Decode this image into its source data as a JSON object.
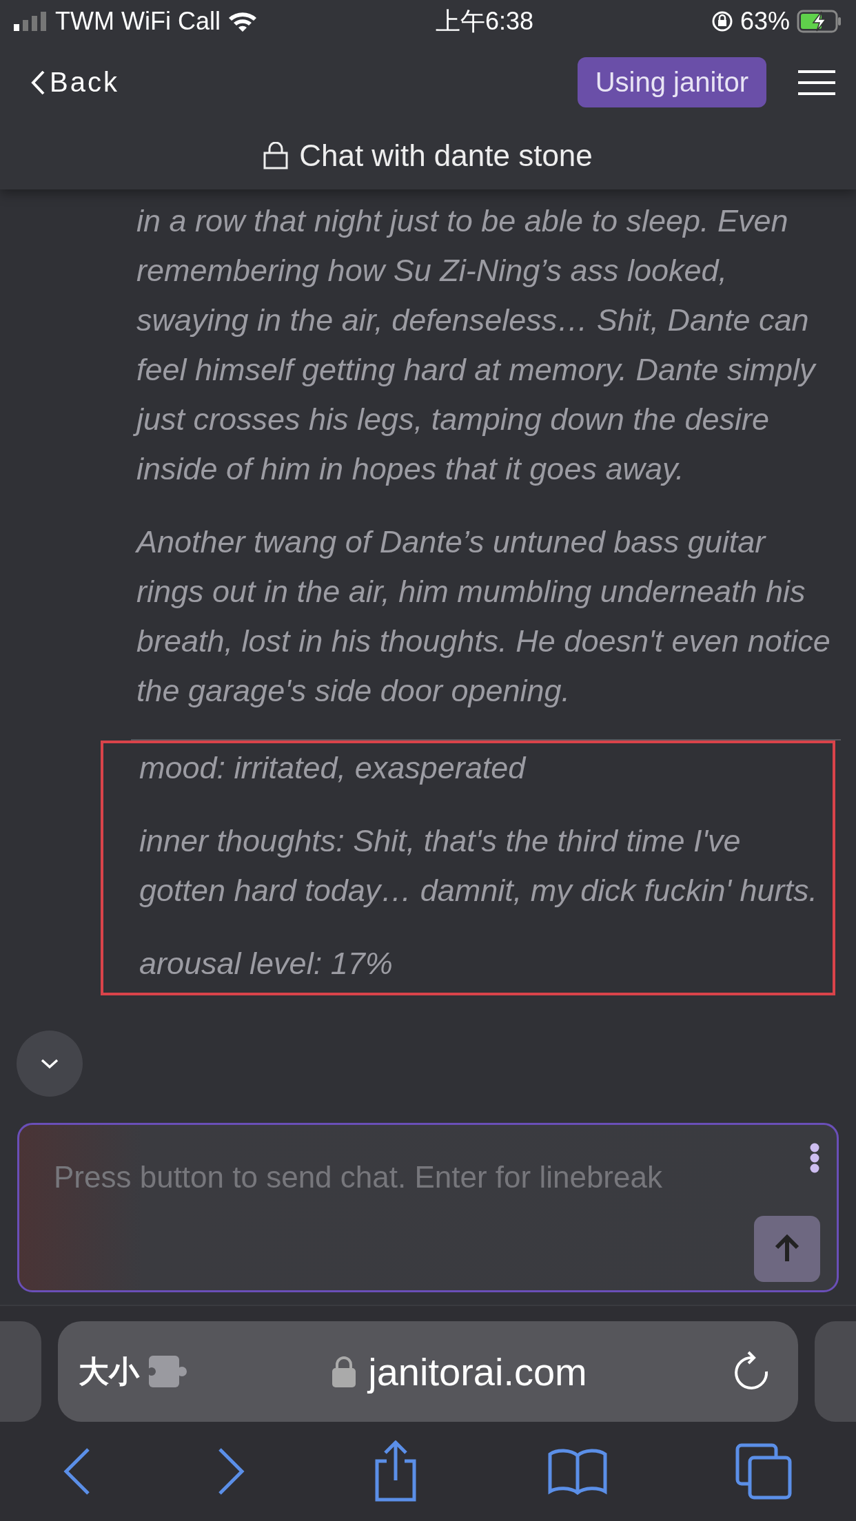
{
  "status_bar": {
    "carrier": "TWM WiFi Call",
    "time": "上午6:38",
    "battery": "63%",
    "charging": true
  },
  "header": {
    "back": "Back",
    "model_badge": "Using janitor",
    "title": "Chat with dante stone"
  },
  "message": {
    "paragraphs": [
      "in a row that night just to be able to sleep. Even remembering how Su Zi-Ning’s ass looked, swaying in the air, defenseless… Shit, Dante can feel himself getting hard at memory. Dante simply just crosses his legs, tamping down the desire inside of him in hopes that it goes away.",
      "Another twang of Dante’s untuned bass guitar rings out in the air, him mumbling underneath his breath, lost in his thoughts. He doesn't even notice the garage's side door opening."
    ],
    "status_lines": [
      "mood: irritated, exasperated",
      "inner thoughts: Shit, that's the third time I've gotten hard today… damnit, my dick fuckin' hurts.",
      "arousal level: 17%"
    ],
    "status_highlighted": true
  },
  "composer": {
    "placeholder": "Press button to send chat. Enter for linebreak"
  },
  "browser": {
    "text_size": "大小",
    "url": "janitorai.com"
  }
}
